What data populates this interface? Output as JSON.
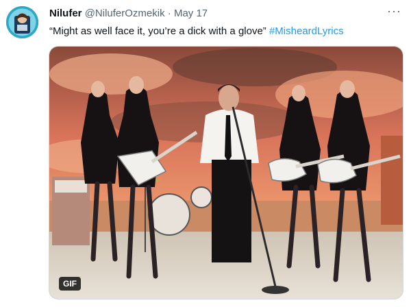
{
  "tweet": {
    "author_name": "Nilufer",
    "author_handle": "@NiluferOzmekik",
    "separator": "·",
    "date": "May 17",
    "more_icon": "more-horizontal-icon",
    "text": "“Might as well face it, you’re a dick with a glove”",
    "hashtag": "#MisheardLyrics",
    "media_badge": "GIF"
  },
  "colors": {
    "link": "#1d9bf0",
    "muted": "#536471",
    "text": "#0f1419"
  }
}
